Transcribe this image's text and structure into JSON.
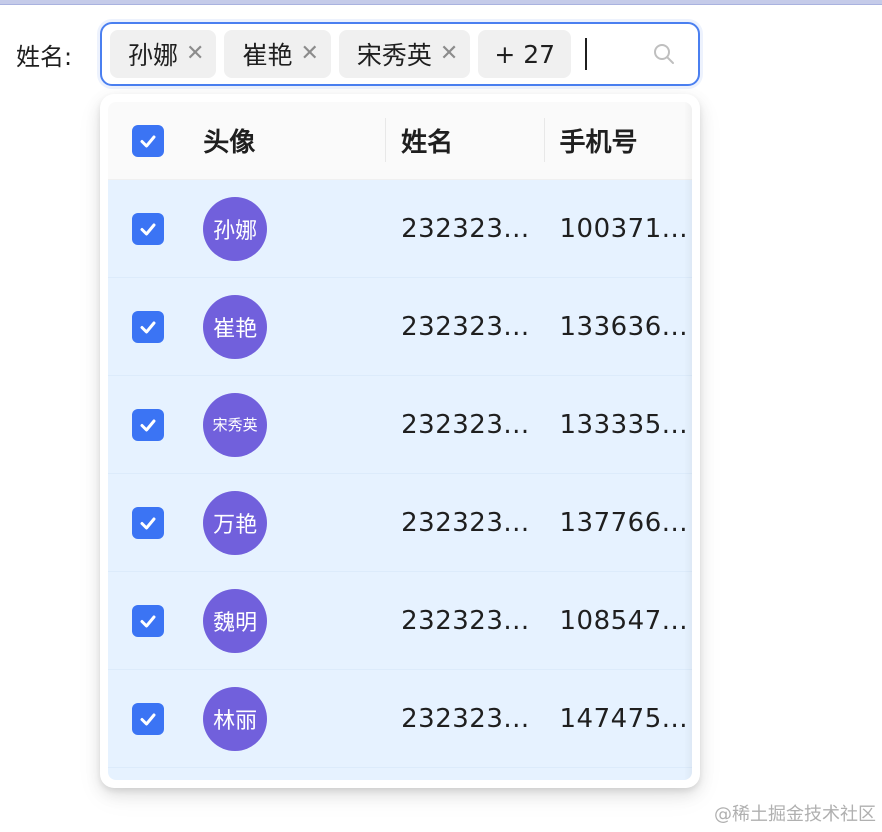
{
  "form": {
    "label": "姓名:",
    "tags": [
      {
        "text": "孙娜"
      },
      {
        "text": "崔艳"
      },
      {
        "text": "宋秀英"
      }
    ],
    "more_tag": "+ 27"
  },
  "table": {
    "headers": {
      "avatar": "头像",
      "name": "姓名",
      "phone": "手机号"
    },
    "rows": [
      {
        "avatar": "孙娜",
        "name": "232323...",
        "phone": "100371..."
      },
      {
        "avatar": "崔艳",
        "name": "232323...",
        "phone": "133636..."
      },
      {
        "avatar": "宋秀英",
        "name": "232323...",
        "phone": "133335..."
      },
      {
        "avatar": "万艳",
        "name": "232323...",
        "phone": "137766..."
      },
      {
        "avatar": "魏明",
        "name": "232323...",
        "phone": "108547..."
      },
      {
        "avatar": "林丽",
        "name": "232323...",
        "phone": "147475..."
      }
    ]
  },
  "colors": {
    "accent": "#3b74f4",
    "avatar_bg": "#7160dc",
    "selected_row": "#e6f2ff"
  },
  "watermark": "@稀土掘金技术社区"
}
